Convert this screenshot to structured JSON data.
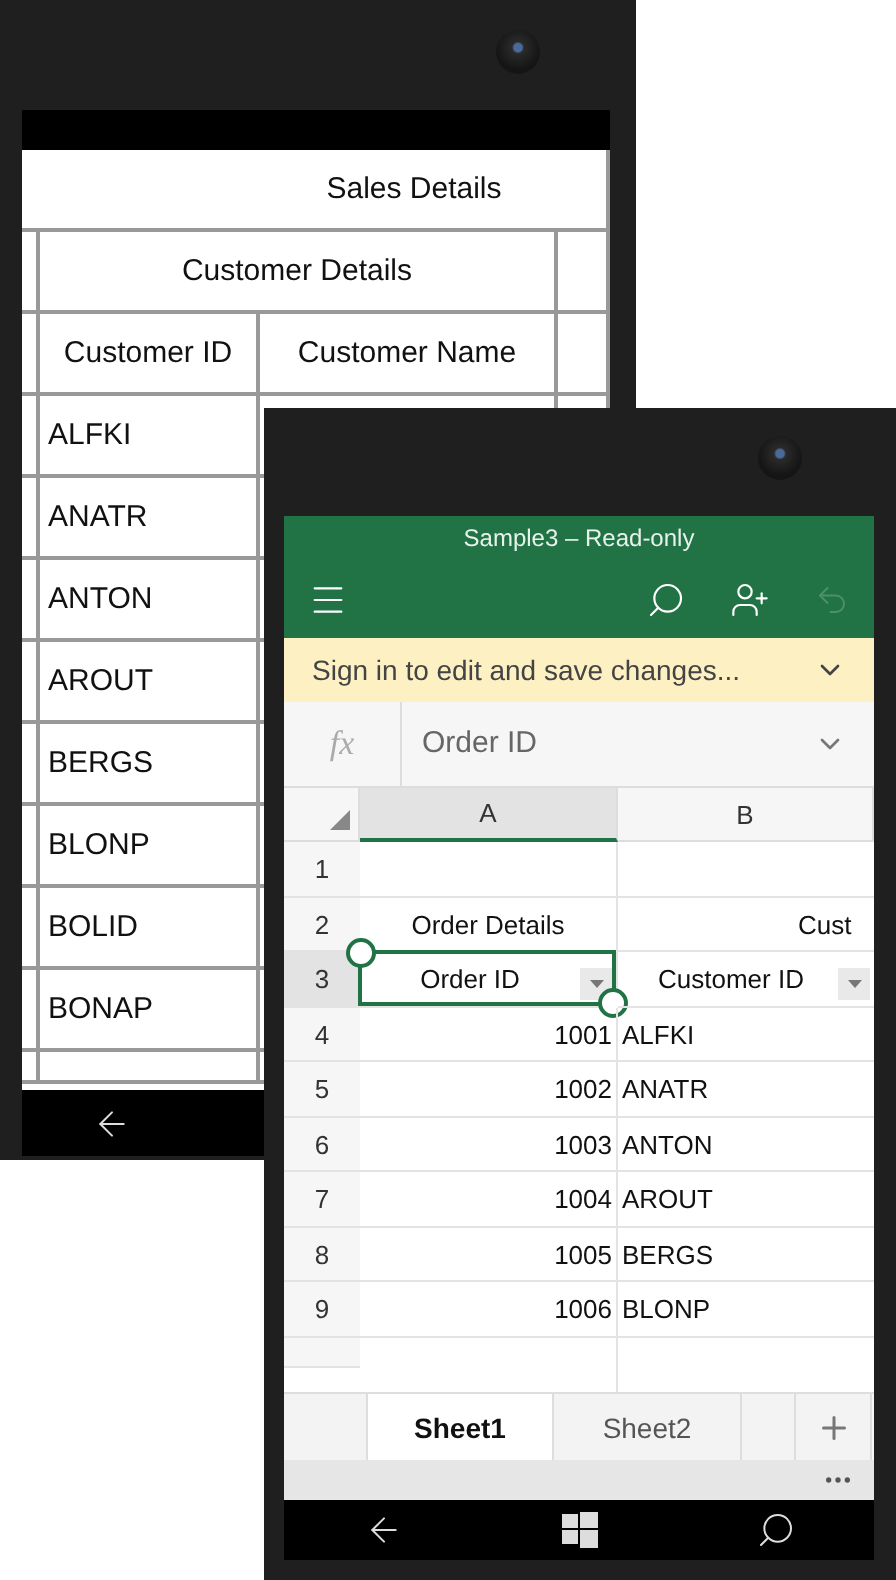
{
  "back_phone": {
    "grid": {
      "title": "Sales Details",
      "group": "Customer Details",
      "columns": [
        "Customer ID",
        "Customer Name"
      ],
      "rows": [
        "ALFKI",
        "ANATR",
        "ANTON",
        "AROUT",
        "BERGS",
        "BLONP",
        "BOLID",
        "BONAP"
      ]
    }
  },
  "front_phone": {
    "title": "Sample3 – Read-only",
    "banner": "Sign in to edit and save changes...",
    "formula_label": "fx",
    "formula": "Order ID",
    "columns": [
      {
        "label": "A",
        "selected": true
      },
      {
        "label": "B",
        "selected": false
      }
    ],
    "rows": [
      {
        "number": "1",
        "kind": "blank",
        "selected": false,
        "cells": []
      },
      {
        "number": "2",
        "kind": "group",
        "selected": false,
        "cells": [
          "Order Details",
          "Cust"
        ]
      },
      {
        "number": "3",
        "kind": "header",
        "selected": true,
        "cells": [
          "Order ID",
          "Customer ID"
        ]
      },
      {
        "number": "4",
        "kind": "data",
        "selected": false,
        "cells": [
          "1001",
          "ALFKI"
        ]
      },
      {
        "number": "5",
        "kind": "data",
        "selected": false,
        "cells": [
          "1002",
          "ANATR"
        ]
      },
      {
        "number": "6",
        "kind": "data",
        "selected": false,
        "cells": [
          "1003",
          "ANTON"
        ]
      },
      {
        "number": "7",
        "kind": "data",
        "selected": false,
        "cells": [
          "1004",
          "AROUT"
        ]
      },
      {
        "number": "8",
        "kind": "data",
        "selected": false,
        "cells": [
          "1005",
          "BERGS"
        ]
      },
      {
        "number": "9",
        "kind": "data",
        "selected": false,
        "cells": [
          "1006",
          "BLONP"
        ]
      }
    ],
    "sheets": [
      {
        "label": "Sheet1",
        "selected": true
      },
      {
        "label": "Sheet2",
        "selected": false
      }
    ]
  }
}
